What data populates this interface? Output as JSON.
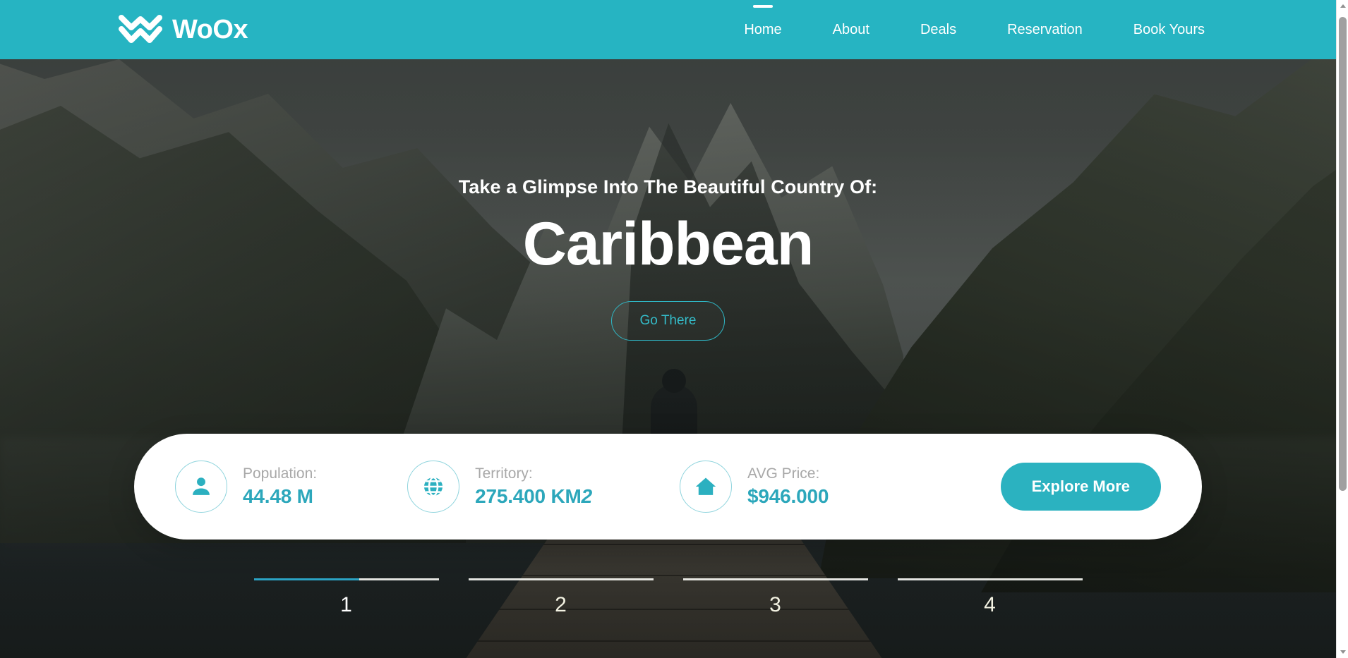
{
  "header": {
    "brand_name": "WoOx",
    "brand_icon": "double-chevron-logo",
    "accent_color": "#26b4c2",
    "nav": [
      {
        "label": "Home",
        "active": true
      },
      {
        "label": "About",
        "active": false
      },
      {
        "label": "Deals",
        "active": false
      },
      {
        "label": "Reservation",
        "active": false
      },
      {
        "label": "Book Yours",
        "active": false
      }
    ]
  },
  "hero": {
    "eyebrow": "Take a Glimpse Into The Beautiful Country Of:",
    "title": "Caribbean",
    "cta_label": "Go There",
    "cta_color": "#34bcc9"
  },
  "stats": {
    "items": [
      {
        "icon": "person-icon",
        "label": "Population:",
        "value": "44.48 M"
      },
      {
        "icon": "globe-icon",
        "label": "Territory:",
        "value": "275.400 KM",
        "unit_sup": "2"
      },
      {
        "icon": "home-icon",
        "label": "AVG Price:",
        "value": "$946.000"
      }
    ],
    "explore_label": "Explore More",
    "value_color": "#2ca7bb",
    "label_color": "#a8a8a8"
  },
  "pagination": {
    "items": [
      {
        "number": "1",
        "active": true
      },
      {
        "number": "2",
        "active": false
      },
      {
        "number": "3",
        "active": false
      },
      {
        "number": "4",
        "active": false
      }
    ],
    "active_fill_color": "#2ba3c4"
  }
}
